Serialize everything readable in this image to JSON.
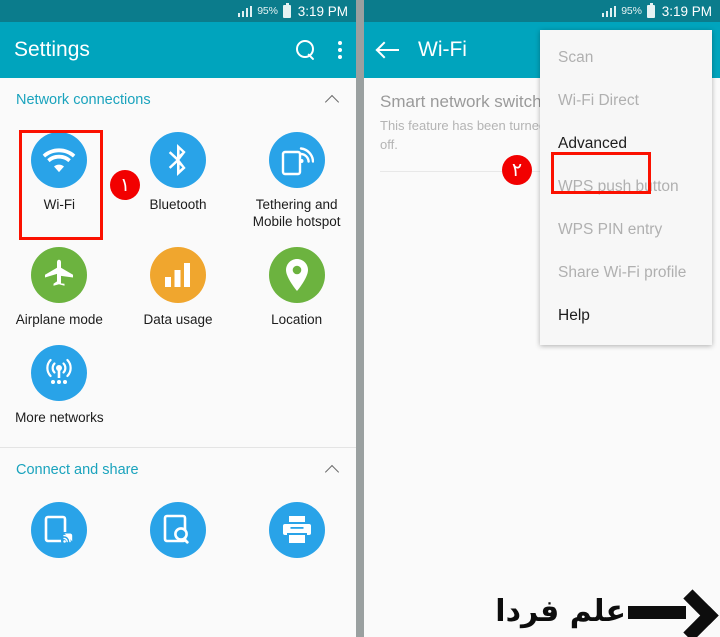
{
  "colors": {
    "statusbar_bg": "#0b7c8c",
    "appbar_bg": "#00a4bd",
    "accent_teal": "#1aa3bd",
    "icon_blue": "#29a3e8",
    "icon_green": "#6cb33f",
    "icon_orange": "#f0a62e",
    "highlight_red": "#fb1100",
    "badge_red": "#f20000",
    "panel_bg": "#fafafa",
    "gap_gray": "#9aa0a0"
  },
  "statusbar": {
    "signal_icon": "signal-bars-icon",
    "battery_percent": "95%",
    "battery_icon": "battery-icon",
    "clock": "3:19 PM"
  },
  "left_panel": {
    "appbar": {
      "title": "Settings",
      "search_icon": "search-icon",
      "overflow_icon": "overflow-menu-icon"
    },
    "sections": [
      {
        "title": "Network connections",
        "collapse_icon": "chevron-up-icon",
        "items": [
          {
            "label": "Wi-Fi",
            "icon": "wifi-icon",
            "color": "#29a3e8"
          },
          {
            "label": "Bluetooth",
            "icon": "bluetooth-icon",
            "color": "#29a3e8"
          },
          {
            "label": "Tethering and\nMobile hotspot",
            "icon": "tethering-icon",
            "color": "#29a3e8"
          },
          {
            "label": "Airplane mode",
            "icon": "airplane-icon",
            "color": "#6cb33f"
          },
          {
            "label": "Data usage",
            "icon": "data-usage-icon",
            "color": "#f0a62e"
          },
          {
            "label": "Location",
            "icon": "location-pin-icon",
            "color": "#6cb33f"
          },
          {
            "label": "More networks",
            "icon": "more-networks-icon",
            "color": "#29a3e8"
          }
        ]
      },
      {
        "title": "Connect and share",
        "collapse_icon": "chevron-up-icon",
        "items": [
          {
            "label": "",
            "icon": "nfc-icon",
            "color": "#29a3e8"
          },
          {
            "label": "",
            "icon": "nearby-scan-icon",
            "color": "#29a3e8"
          },
          {
            "label": "",
            "icon": "printer-icon",
            "color": "#29a3e8"
          }
        ]
      }
    ]
  },
  "right_panel": {
    "appbar": {
      "title": "Wi-Fi",
      "back_icon": "back-arrow-icon"
    },
    "smart_network_switch": {
      "title": "Smart network switch",
      "subtitle": "This feature has been turned off because mobile data is off."
    },
    "menu": {
      "items": [
        {
          "label": "Scan",
          "enabled": false
        },
        {
          "label": "Wi-Fi Direct",
          "enabled": false
        },
        {
          "label": "Advanced",
          "enabled": true
        },
        {
          "label": "WPS push button",
          "enabled": false
        },
        {
          "label": "WPS PIN entry",
          "enabled": false
        },
        {
          "label": "Share Wi-Fi profile",
          "enabled": false
        },
        {
          "label": "Help",
          "enabled": true
        }
      ]
    }
  },
  "annotations": {
    "step_one_badge": "١",
    "step_two_badge": "٢"
  },
  "watermark": {
    "text": "علم فردا",
    "arrow_icon": "right-arrow-icon"
  }
}
